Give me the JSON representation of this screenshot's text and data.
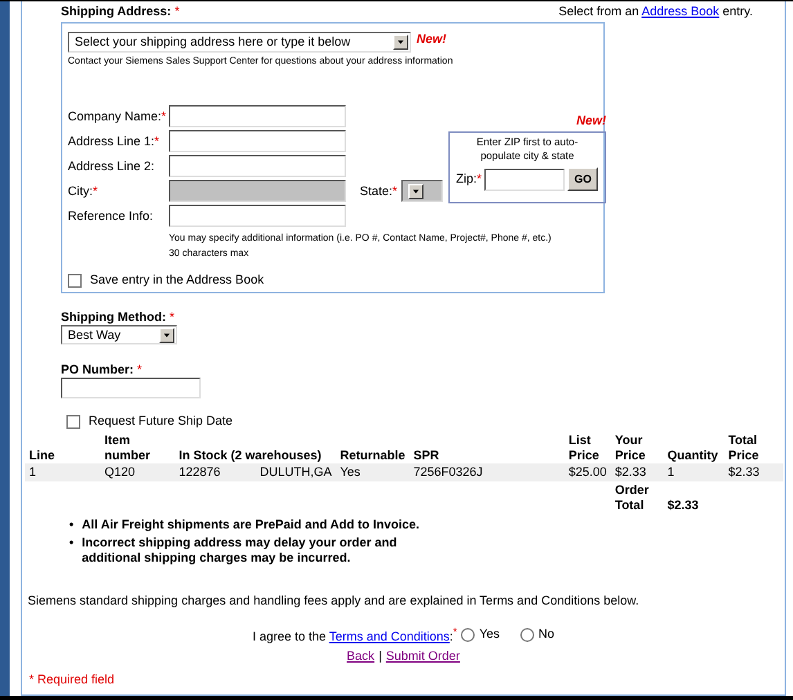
{
  "required_mark": "*",
  "shipping_address": {
    "label": "Shipping Address:",
    "required": true,
    "address_book_prefix": "Select from an",
    "address_book_link": "Address Book",
    "address_book_suffix": "entry.",
    "address_select": {
      "value": "Select your shipping address here or type it below"
    },
    "new_badge": "New!",
    "contact_note": "Contact your Siemens Sales Support Center for questions about your address information",
    "fields": [
      {
        "label": "Company Name:",
        "required": true,
        "disabled": false
      },
      {
        "label": "Address Line 1:",
        "required": true,
        "disabled": false
      },
      {
        "label": "Address Line 2:",
        "required": false,
        "disabled": false
      },
      {
        "label": "City:",
        "required": true,
        "disabled": true
      },
      {
        "label": "Reference Info:",
        "required": false,
        "disabled": false
      }
    ],
    "state": {
      "label": "State:",
      "required": true,
      "disabled": true
    },
    "zip_box": {
      "new_badge": "New!",
      "hint": "Enter ZIP first to auto-populate city & state",
      "label": "Zip:",
      "required": true,
      "button": "GO"
    },
    "reference_hint": [
      "You may specify additional information (i.e. PO #, Contact Name, Project#, Phone #, etc.)",
      "30 characters max"
    ],
    "save_entry": {
      "label": "Save entry in the Address Book",
      "checked": false
    }
  },
  "shipping_method": {
    "label": "Shipping Method:",
    "required": true,
    "value": "Best Way"
  },
  "po_number": {
    "label": "PO Number:",
    "required": true
  },
  "future_ship_date": {
    "label": "Request Future Ship Date",
    "checked": false
  },
  "table": {
    "columns": [
      "Line",
      "Item number",
      "In Stock (2 warehouses)",
      "Returnable",
      "SPR",
      "List Price",
      "Your Price",
      "Quantity",
      "Total Price"
    ],
    "rows": [
      [
        "1",
        "Q120",
        [
          "122876",
          "DULUTH,GA"
        ],
        "Yes",
        "7256F0326J",
        "$25.00",
        "$2.33",
        "1",
        "$2.33"
      ]
    ],
    "order_total": {
      "label": "Order Total",
      "value": "$2.33"
    }
  },
  "notes": {
    "marker": "•",
    "items": [
      "All Air Freight shipments are PrePaid and Add to Invoice.",
      "Incorrect shipping address may delay your order and additional shipping charges may be incurred."
    ]
  },
  "shipping_charges_note": "Siemens standard shipping charges and handling fees apply and are explained in Terms and Conditions below.",
  "agreement": {
    "prefix": "I agree to the",
    "link": "Terms and Conditions",
    "suffix": ":",
    "required": true,
    "options": [
      {
        "label": "Yes",
        "selected": false
      },
      {
        "label": "No",
        "selected": false
      }
    ]
  },
  "actions": {
    "back": "Back",
    "separator": "|",
    "submit": "Submit Order"
  },
  "required_note": "* Required field"
}
